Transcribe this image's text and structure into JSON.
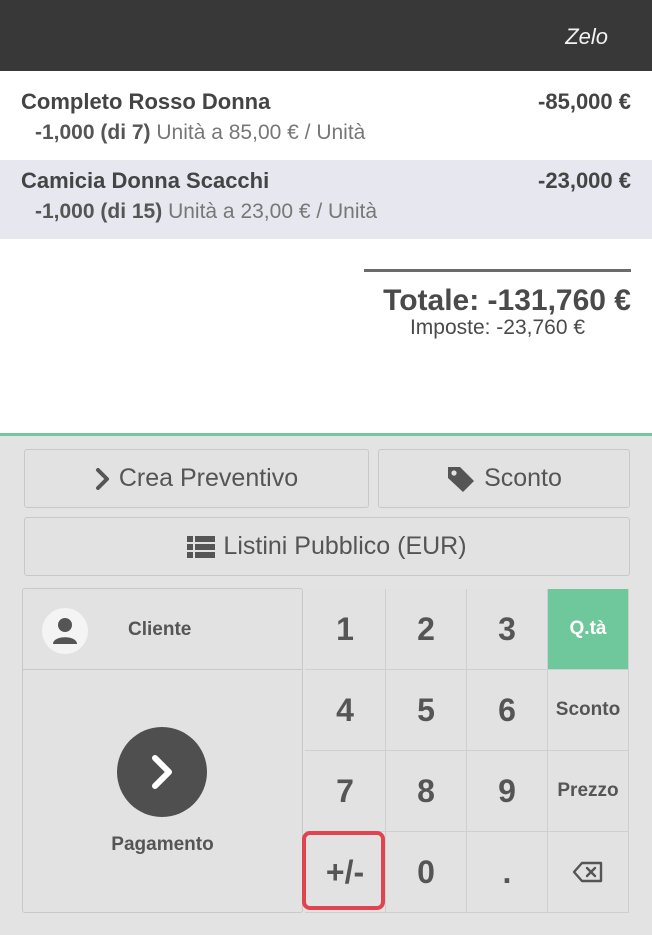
{
  "header": {
    "user_name": "Zelo"
  },
  "orderlines": [
    {
      "product": "Completo Rosso Donna",
      "price": "-85,000 €",
      "qty": "-1,000 (di 7)",
      "unit_info": " Unità a 85,00 € / Unità",
      "selected": false
    },
    {
      "product": "Camicia Donna Scacchi",
      "price": "-23,000 €",
      "qty": "-1,000 (di 15)",
      "unit_info": " Unità a 23,00 € / Unità",
      "selected": true
    }
  ],
  "summary": {
    "total": "Totale: -131,760 €",
    "taxes": "Imposte: -23,760 €"
  },
  "actions": {
    "quotation_label": "Crea Preventivo",
    "discount_label": "Sconto",
    "pricelist_label": "Listini Pubblico (EUR)"
  },
  "customer_label": "Cliente",
  "payment_label": "Pagamento",
  "numpad": {
    "keys": [
      "1",
      "2",
      "3",
      "4",
      "5",
      "6",
      "7",
      "8",
      "9",
      "+/-",
      "0",
      "."
    ],
    "modes": [
      "Q.tà",
      "Sconto",
      "Prezzo"
    ],
    "active_mode": "Q.tà",
    "backspace_icon": "backspace-icon"
  },
  "colors": {
    "accent": "#6ec89b",
    "header": "#383838",
    "selected_row": "#e6e7ef",
    "highlight": "#e0444e"
  }
}
